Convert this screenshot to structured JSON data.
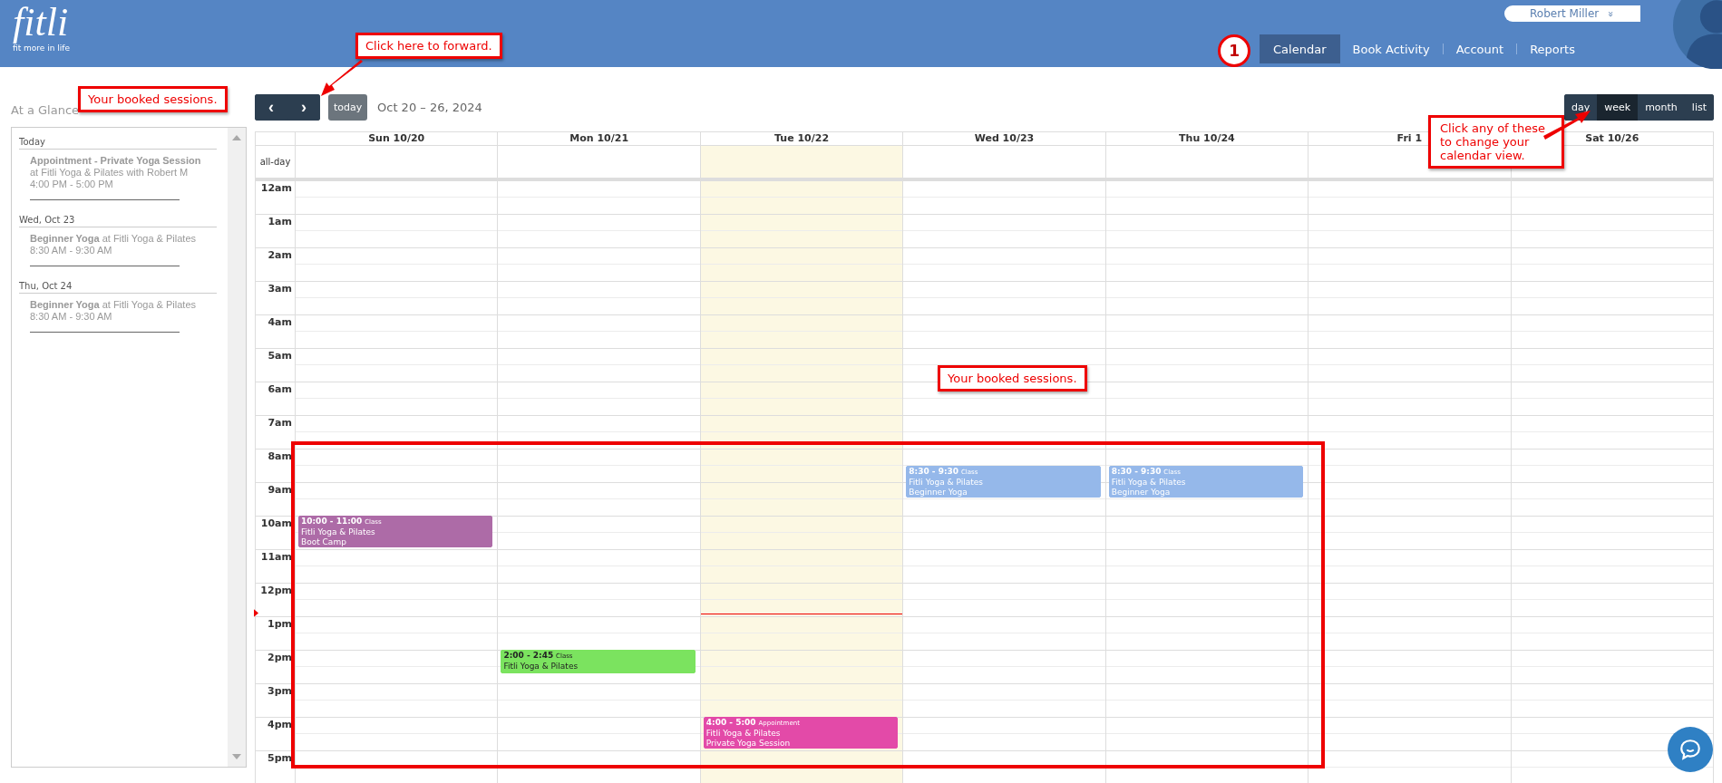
{
  "logo": {
    "name": "fitli",
    "tagline": "fit more in life"
  },
  "user": {
    "name": "Robert Miller",
    "menu_glyph": "»"
  },
  "step_marker": "1",
  "nav": [
    {
      "label": "Calendar",
      "selected": true
    },
    {
      "label": "Book Activity",
      "selected": false
    },
    {
      "label": "Account",
      "selected": false
    },
    {
      "label": "Reports",
      "selected": false
    }
  ],
  "sidebar": {
    "title": "At a Glance",
    "groups": [
      {
        "heading": "Today",
        "items": [
          {
            "title": "**Appointment - Private Yoga Session**",
            "detail": "at Fitli Yoga & Pilates with Robert M",
            "time": "4:00 PM - 5:00 PM"
          }
        ]
      },
      {
        "heading": "Wed, Oct 23",
        "items": [
          {
            "title": "**Beginner Yoga** at Fitli Yoga & Pilates",
            "time": "8:30 AM - 9:30 AM"
          }
        ]
      },
      {
        "heading": "Thu, Oct 24",
        "items": [
          {
            "title": "**Beginner Yoga** at Fitli Yoga & Pilates",
            "time": "8:30 AM - 9:30 AM"
          }
        ]
      }
    ]
  },
  "toolbar": {
    "prev": "‹",
    "next": "›",
    "today": "today",
    "range": "Oct 20 – 26, 2024"
  },
  "views": [
    {
      "label": "day",
      "selected": false
    },
    {
      "label": "week",
      "selected": true
    },
    {
      "label": "month",
      "selected": false
    },
    {
      "label": "list",
      "selected": false
    }
  ],
  "calendar": {
    "allday_label": "all-day",
    "hours": [
      "12am",
      "1am",
      "2am",
      "3am",
      "4am",
      "5am",
      "6am",
      "7am",
      "8am",
      "9am",
      "10am",
      "11am",
      "12pm",
      "1pm",
      "2pm",
      "3pm",
      "4pm",
      "5pm"
    ],
    "days": [
      {
        "label": "Sun 10/20",
        "today": false,
        "events": [
          {
            "time": "10:00 - 11:00",
            "type": "Class",
            "venue": "Fitli Yoga & Pilates",
            "name": "Boot Camp",
            "color": "#ad6ba7"
          }
        ]
      },
      {
        "label": "Mon 10/21",
        "today": false,
        "events": [
          {
            "time": "2:00 - 2:45",
            "type": "Class",
            "venue": "Fitli Yoga & Pilates",
            "color": "#7be35f"
          }
        ]
      },
      {
        "label": "Tue 10/22",
        "today": true,
        "events": [
          {
            "time": "4:00 - 5:00",
            "type": "Appointment",
            "venue": "Fitli Yoga & Pilates",
            "name": "Private Yoga Session",
            "color": "#e34aa8"
          }
        ]
      },
      {
        "label": "Wed 10/23",
        "today": false,
        "events": [
          {
            "time": "8:30 - 9:30",
            "type": "Class",
            "venue": "Fitli Yoga & Pilates",
            "name": "Beginner Yoga",
            "color": "#95b8ea"
          }
        ]
      },
      {
        "label": "Thu 10/24",
        "today": false,
        "events": [
          {
            "time": "8:30 - 9:30",
            "type": "Class",
            "venue": "Fitli Yoga & Pilates",
            "name": "Beginner Yoga",
            "color": "#95b8ea"
          }
        ]
      },
      {
        "label": "Fri 1",
        "today": false
      },
      {
        "label": "Sat 10/26",
        "today": false
      }
    ]
  },
  "annotations": [
    {
      "kind": "forward",
      "text": "Click here to forward."
    },
    {
      "kind": "left",
      "text": "Your booked sessions."
    },
    {
      "kind": "middle",
      "text": "Your booked sessions."
    },
    {
      "kind": "views",
      "text": "Click any of these to change your calendar view."
    }
  ]
}
